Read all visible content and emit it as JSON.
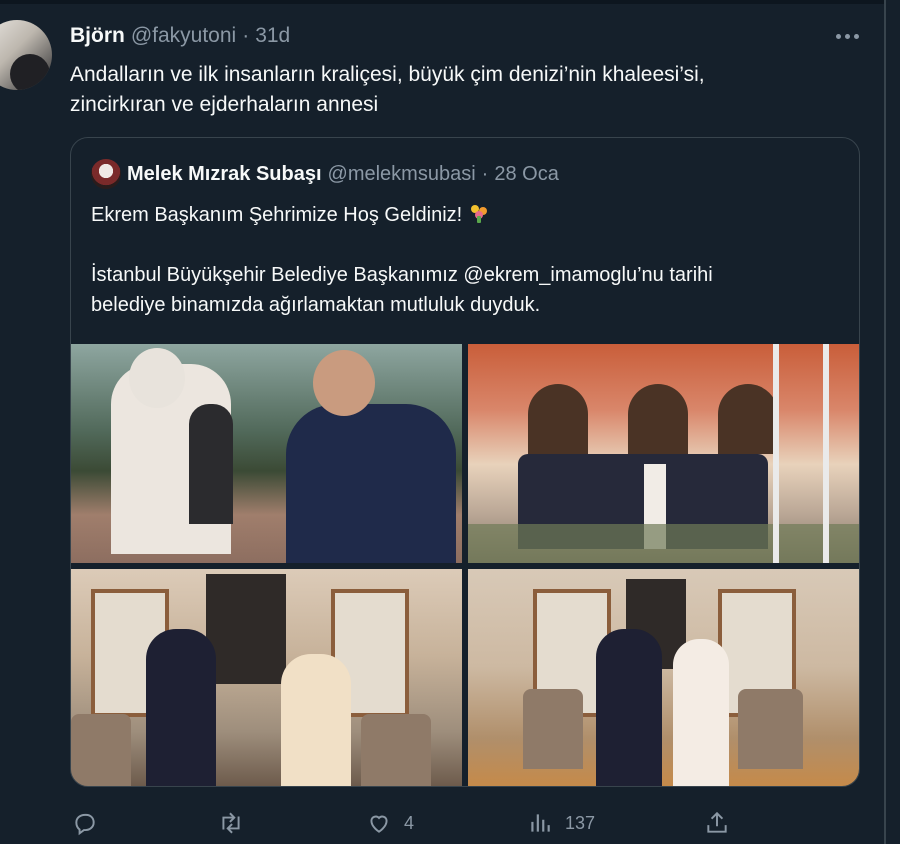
{
  "tweet": {
    "author_name": "Björn",
    "handle": "@fakyutoni",
    "separator": "·",
    "time": "31d",
    "text_line1": "Andalların ve ilk insanların kraliçesi, büyük çim denizi’nin khaleesi’si,",
    "text_line2": "zincirkıran ve ejderhaların annesi"
  },
  "quoted": {
    "author_name": "Melek Mızrak Subaşı",
    "handle": "@melekmsubasi",
    "separator": "·",
    "time": "28 Oca",
    "line1": "Ekrem Başkanım Şehrimize Hoş Geldiniz!",
    "line2": "İstanbul Büyükşehir Belediye Başkanımız @ekrem_imamoglu’nu tarihi",
    "line3": "belediye binamızda ağırlamaktan mutluluk duyduk."
  },
  "actions": {
    "reply_count": "",
    "retweet_count": "",
    "like_count": "4",
    "views_count": "137"
  },
  "icons": [
    "more-icon",
    "reply-icon",
    "retweet-icon",
    "like-icon",
    "views-icon",
    "share-icon",
    "bouquet-icon"
  ],
  "colors": {
    "background": "#15202b",
    "secondary_text": "#8b98a5",
    "border": "#38444d"
  }
}
